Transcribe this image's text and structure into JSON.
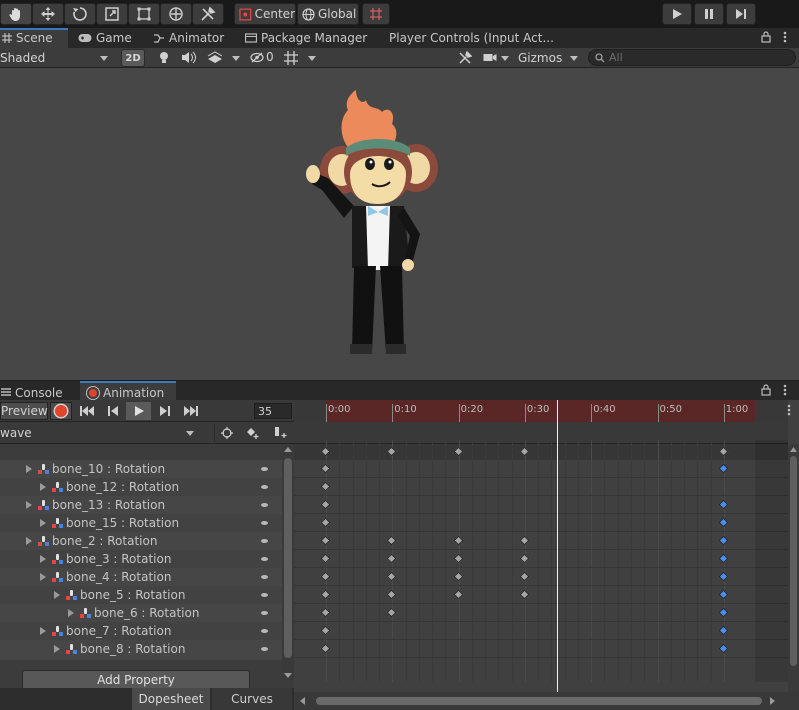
{
  "toolbar": {
    "pivot": "Center",
    "space": "Global",
    "tools": [
      "hand-icon",
      "move-icon",
      "rotate-icon",
      "scale-icon",
      "rect-tool-icon",
      "transform-icon",
      "custom-tool-icon"
    ]
  },
  "tabs": {
    "scene": "Scene",
    "game": "Game",
    "animator": "Animator",
    "package_manager": "Package Manager",
    "player_controls": "Player Controls (Input Act..."
  },
  "scene_toolbar": {
    "draw_mode": "Shaded",
    "two_d": "2D",
    "hidden_count": "0",
    "gizmos": "Gizmos",
    "search_placeholder": "All"
  },
  "bottom_tabs": {
    "console": "Console",
    "animation": "Animation"
  },
  "animation": {
    "preview": "Preview",
    "frame": "35",
    "clip": "wave",
    "add_property": "Add Property",
    "dopesheet": "Dopesheet",
    "curves": "Curves",
    "time_labels": [
      "0:00",
      "0:10",
      "0:20",
      "0:30",
      "0:40",
      "0:50",
      "1:00"
    ],
    "properties": [
      {
        "label": "bone_10 : Rotation",
        "depth": 0
      },
      {
        "label": "bone_12 : Rotation",
        "depth": 1
      },
      {
        "label": "bone_13 : Rotation",
        "depth": 0
      },
      {
        "label": "bone_15 : Rotation",
        "depth": 1
      },
      {
        "label": "bone_2 : Rotation",
        "depth": 0
      },
      {
        "label": "bone_3 : Rotation",
        "depth": 1
      },
      {
        "label": "bone_4 : Rotation",
        "depth": 1
      },
      {
        "label": "bone_5 : Rotation",
        "depth": 2
      },
      {
        "label": "bone_6 : Rotation",
        "depth": 3
      },
      {
        "label": "bone_7 : Rotation",
        "depth": 1
      },
      {
        "label": "bone_8 : Rotation",
        "depth": 2
      }
    ]
  },
  "colors": {
    "record_red": "#e0442a",
    "selected_key": "#4f8ee8",
    "timeline_red": "#5c2a2a"
  }
}
